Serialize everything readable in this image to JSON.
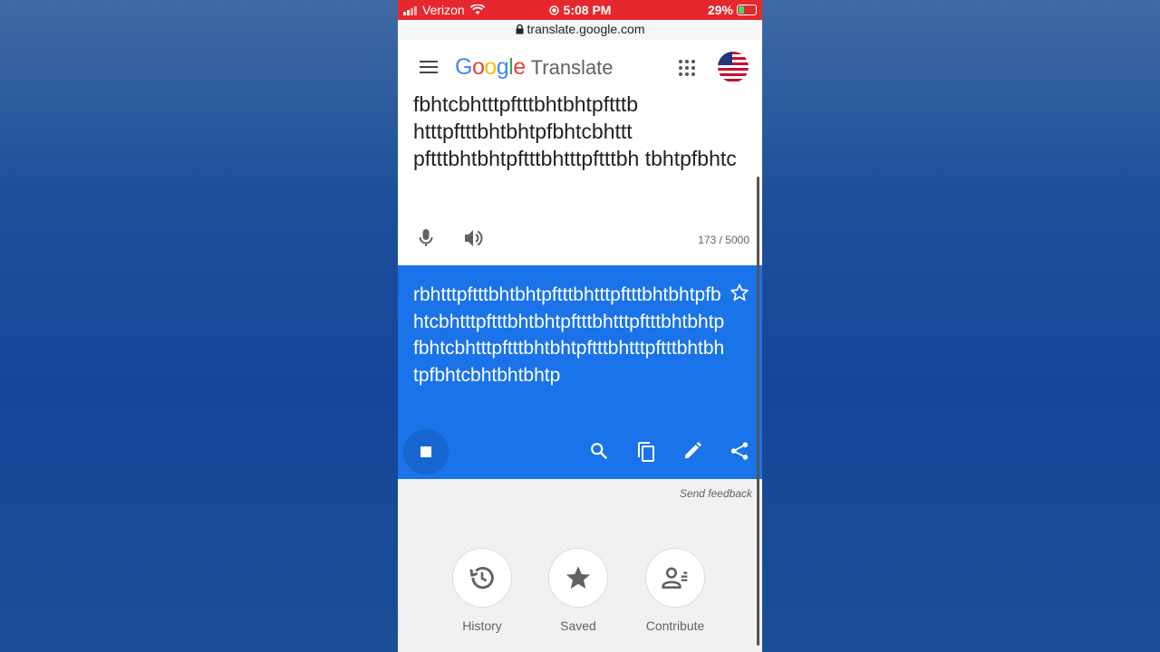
{
  "statusbar": {
    "carrier": "Verizon",
    "time": "5:08 PM",
    "battery": "29%",
    "battery_level": 0.29
  },
  "urlbar": {
    "url": "translate.google.com"
  },
  "header": {
    "logo_letters": [
      {
        "ch": "G",
        "color": "#4285f4"
      },
      {
        "ch": "o",
        "color": "#ea4335"
      },
      {
        "ch": "o",
        "color": "#fbbc05"
      },
      {
        "ch": "g",
        "color": "#4285f4"
      },
      {
        "ch": "l",
        "color": "#34a853"
      },
      {
        "ch": "e",
        "color": "#ea4335"
      }
    ],
    "product": "Translate"
  },
  "source": {
    "text": "fbhtcbhtttpftttbhtbhtpftttb htttpftttbhtbhtpfbhtcbhttt pftttbhtbhtpftttbhtttpftttbh tbhtpfbhtc",
    "char_count": "173 / 5000"
  },
  "result": {
    "text": "rbhtttpftttbhtbhtpftttbhtttpftttbhtbhtpfbhtcbhtttpftttbhtbhtpftttbhtttpftttbhtbhtpfbhtcbhtttpftttbhtbhtpftttbhtttpftttbhtbhtpfbhtcbhtbhtbhtp"
  },
  "feedback": {
    "label": "Send feedback"
  },
  "quick_actions": [
    {
      "label": "History",
      "icon": "history-icon"
    },
    {
      "label": "Saved",
      "icon": "star-icon"
    },
    {
      "label": "Contribute",
      "icon": "contribute-icon"
    }
  ],
  "colors": {
    "accent": "#1a73e8",
    "status_bar": "#e5282e"
  }
}
